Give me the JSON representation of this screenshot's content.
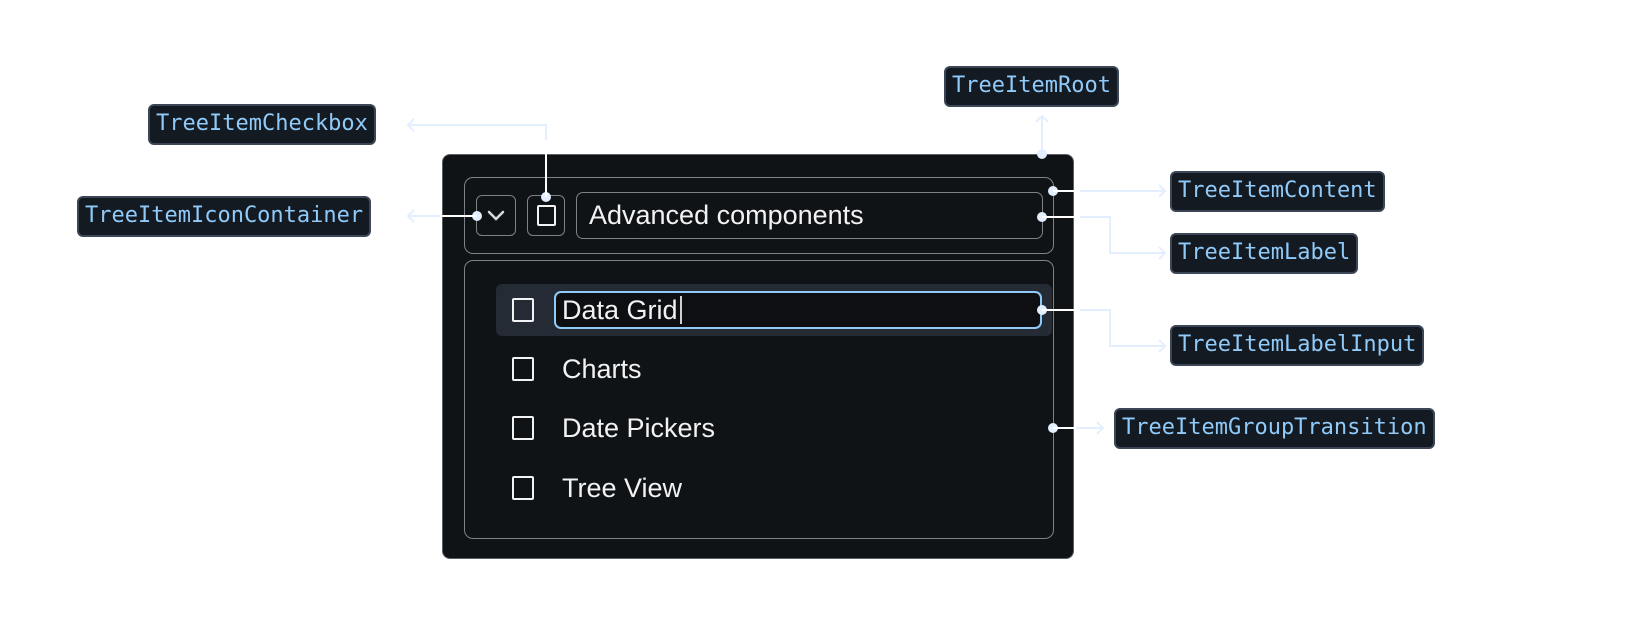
{
  "tree": {
    "parent_label": "Advanced components",
    "children": [
      {
        "label": "Data Grid",
        "editing": true,
        "selected": true
      },
      {
        "label": "Charts"
      },
      {
        "label": "Date Pickers"
      },
      {
        "label": "Tree View"
      }
    ]
  },
  "annotations": {
    "root": "TreeItemRoot",
    "checkbox": "TreeItemCheckbox",
    "icon_container": "TreeItemIconContainer",
    "content": "TreeItemContent",
    "label": "TreeItemLabel",
    "label_input": "TreeItemLabelInput",
    "group_transition": "TreeItemGroupTransition"
  },
  "colors": {
    "tag_text": "#90caf9",
    "tag_bg": "#141a22",
    "input_focus": "#90caf9",
    "connector": "#e3efff"
  }
}
